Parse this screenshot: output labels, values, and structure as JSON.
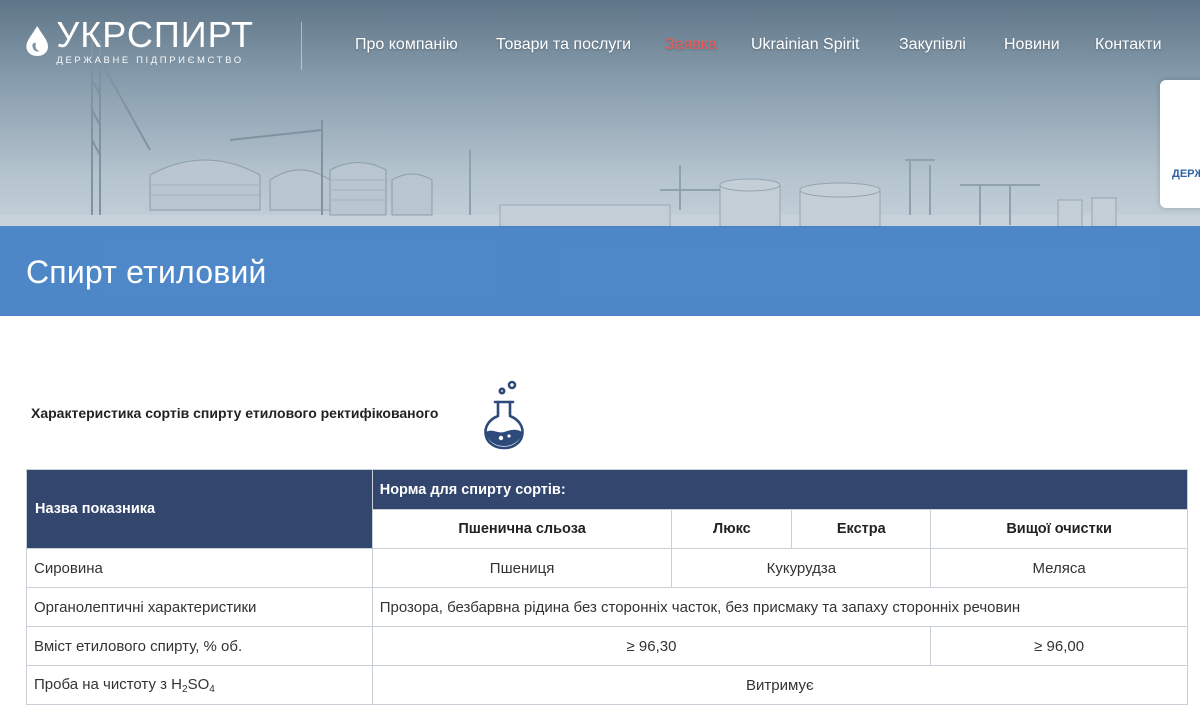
{
  "logo": {
    "brand": "УКРСПИРТ",
    "subtitle": "ДЕРЖАВНЕ ПІДПРИЄМСТВО"
  },
  "nav": {
    "items": [
      {
        "label": "Про компанію",
        "active": false
      },
      {
        "label": "Товари та послуги",
        "active": false
      },
      {
        "label": "Заявка",
        "active": true
      },
      {
        "label": "Ukrainian Spirit",
        "active": false
      },
      {
        "label": "Закупівлі",
        "active": false
      },
      {
        "label": "Новини",
        "active": false
      },
      {
        "label": "Контакти",
        "active": false
      }
    ],
    "active_color": "#ec5b5b"
  },
  "side_tab": {
    "label": "ДЕРЖ"
  },
  "page_title": "Спирт етиловий",
  "section": {
    "title": "Характеристика сортів спирту етилового ректифікованого",
    "icon": "flask-icon"
  },
  "table": {
    "header_main": "Назва показника",
    "header_norm": "Норма для спирту сортів:",
    "grades": [
      "Пшенична сльоза",
      "Люкс",
      "Екстра",
      "Вищої очистки"
    ],
    "rows": [
      {
        "label": "Сировина",
        "cells": [
          "Пшениця",
          "Кукурудза",
          "Меляса"
        ]
      },
      {
        "label": "Органолептичні характеристики",
        "cells": [
          "Прозора, безбарвна рідина без сторонніх часток, без присмаку та запаху сторонніх речовин"
        ]
      },
      {
        "label": "Вміст етилового спирту, % об.",
        "cells": [
          "≥ 96,30",
          "≥ 96,00"
        ]
      },
      {
        "label_prefix": "Проба на чистоту з H",
        "label_sub1": "2",
        "label_mid": "SO",
        "label_sub2": "4",
        "cells": [
          "Витримує"
        ]
      }
    ]
  },
  "colors": {
    "header_bg": "#33476e",
    "title_band": "#3a7ac4",
    "flask_icon": "#2e4a7a"
  }
}
